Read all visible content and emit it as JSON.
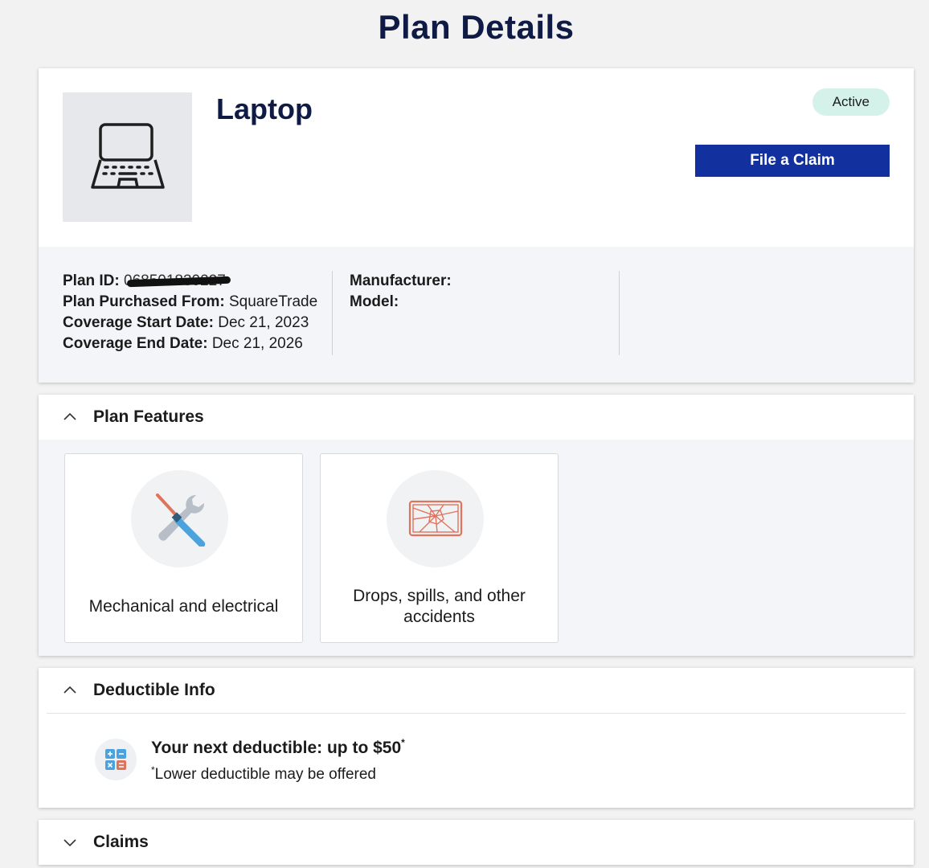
{
  "page": {
    "title": "Plan Details"
  },
  "product": {
    "name": "Laptop",
    "status": "Active",
    "claim_button": "File a Claim",
    "details": {
      "plan_id_label": "Plan ID:",
      "plan_id_value": "068501830227",
      "purchased_from_label": "Plan Purchased From:",
      "purchased_from_value": "SquareTrade",
      "start_label": "Coverage Start Date:",
      "start_value": "Dec 21, 2023",
      "end_label": "Coverage End Date:",
      "end_value": "Dec 21, 2026",
      "manufacturer_label": "Manufacturer:",
      "manufacturer_value": "",
      "model_label": "Model:",
      "model_value": ""
    }
  },
  "features": {
    "title": "Plan Features",
    "items": [
      {
        "label": "Mechanical and electrical",
        "icon": "tools-icon"
      },
      {
        "label": "Drops, spills, and other accidents",
        "icon": "cracked-screen-icon"
      }
    ]
  },
  "deductible": {
    "title": "Deductible Info",
    "main": "Your next deductible: up to $50",
    "main_mark": "*",
    "note_mark": "*",
    "note": "Lower deductible may be offered",
    "icon": "calculator-icon"
  },
  "claims": {
    "title": "Claims"
  },
  "colors": {
    "navy": "#0f1b44",
    "button": "#12309e",
    "badge": "#d5f2ea",
    "accent_blue": "#4aa3df",
    "accent_coral": "#e0735c"
  }
}
